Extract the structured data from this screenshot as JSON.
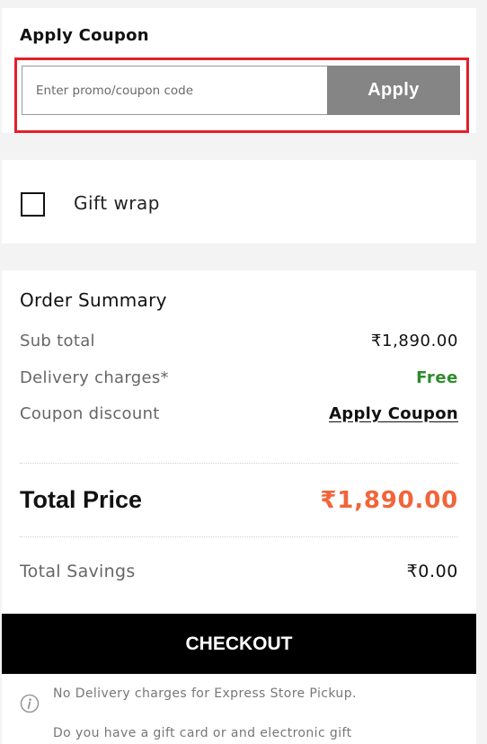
{
  "coupon": {
    "title": "Apply Coupon",
    "input_placeholder": "Enter promo/coupon code",
    "input_value": "",
    "apply_label": "Apply"
  },
  "gift_wrap": {
    "label": "Gift wrap",
    "checked": false
  },
  "summary": {
    "title": "Order Summary",
    "subtotal_label": "Sub total",
    "subtotal_value": "₹1,890.00",
    "delivery_label": "Delivery charges*",
    "delivery_value": "Free",
    "coupon_label": "Coupon discount",
    "coupon_link": "Apply Coupon",
    "total_label": "Total Price",
    "total_value": "₹1,890.00",
    "savings_label": "Total Savings",
    "savings_value": "₹0.00"
  },
  "checkout_label": "CHECKOUT",
  "notes": {
    "icon": "info-icon",
    "delivery_note": "No Delivery charges for Express Store Pickup.",
    "gift_card_note": "Do you have a gift card or and electronic gift"
  },
  "colors": {
    "highlight_border": "#e3202b",
    "apply_button": "#858585",
    "free_text": "#2e8b2e",
    "total_price": "#f2643a",
    "checkout_bg": "#000000"
  }
}
